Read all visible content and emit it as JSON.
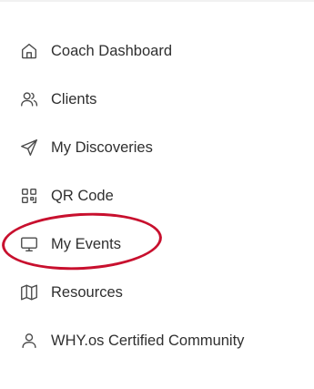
{
  "sidebar": {
    "items": [
      {
        "label": "Coach Dashboard",
        "icon": "home-icon"
      },
      {
        "label": "Clients",
        "icon": "users-icon"
      },
      {
        "label": "My Discoveries",
        "icon": "send-icon"
      },
      {
        "label": "QR Code",
        "icon": "qr-code-icon"
      },
      {
        "label": "My Events",
        "icon": "monitor-icon"
      },
      {
        "label": "Resources",
        "icon": "map-icon"
      },
      {
        "label": "WHY.os Certified Community",
        "icon": "user-icon"
      }
    ]
  },
  "annotation": {
    "highlight_color": "#c8102e",
    "highlighted_item": "My Events"
  }
}
